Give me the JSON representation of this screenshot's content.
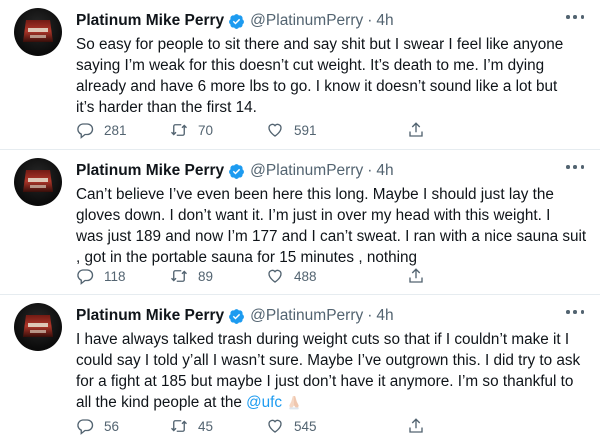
{
  "tweets": [
    {
      "name": "Platinum Mike Perry",
      "handle": "@PlatinumPerry",
      "separator": "·",
      "time": "4h",
      "text_lines": [
        "So easy for people to sit there and say shit but I swear I feel like anyone",
        "saying I’m weak for this doesn’t cut weight. It’s death to me. I’m dying",
        "already and have 6 more lbs to go. I know it doesn’t sound like a lot but",
        "it’s harder than the first 14."
      ],
      "replies": "281",
      "retweets": "70",
      "likes": "591"
    },
    {
      "name": "Platinum Mike Perry",
      "handle": "@PlatinumPerry",
      "separator": "·",
      "time": "4h",
      "text_lines": [
        "Can’t believe I’ve even been here this long. Maybe I should just lay the",
        "gloves down. I don’t want it. I’m just in over my head with this weight. I",
        "was just 189 and now I’m 177 and I can’t sweat. I ran with a nice sauna suit",
        ", got in the portable sauna for 15 minutes , nothing"
      ],
      "replies": "118",
      "retweets": "89",
      "likes": "488"
    },
    {
      "name": "Platinum Mike Perry",
      "handle": "@PlatinumPerry",
      "separator": "·",
      "time": "4h",
      "text_lines": [
        "I have always talked trash during weight cuts so that if I couldn’t make it I",
        "could say I told y’all I wasn’t sure. Maybe I’ve outgrown this. I did try to ask",
        "for a fight at 185 but maybe I just don’t have it anymore. I’m so thankful to",
        "all the kind people at the"
      ],
      "mention": "@ufc",
      "emoji": "folded-hands",
      "replies": "56",
      "retweets": "45",
      "likes": "545"
    }
  ],
  "icons": {
    "reply": "reply-icon",
    "retweet": "retweet-icon",
    "like": "like-icon",
    "share": "share-icon",
    "verified": "verified-badge-icon",
    "more": "more-options-icon"
  },
  "colors": {
    "accent": "#1d9bf0",
    "text": "#0f1419",
    "muted": "#536471",
    "divider": "#e6ecf0"
  }
}
